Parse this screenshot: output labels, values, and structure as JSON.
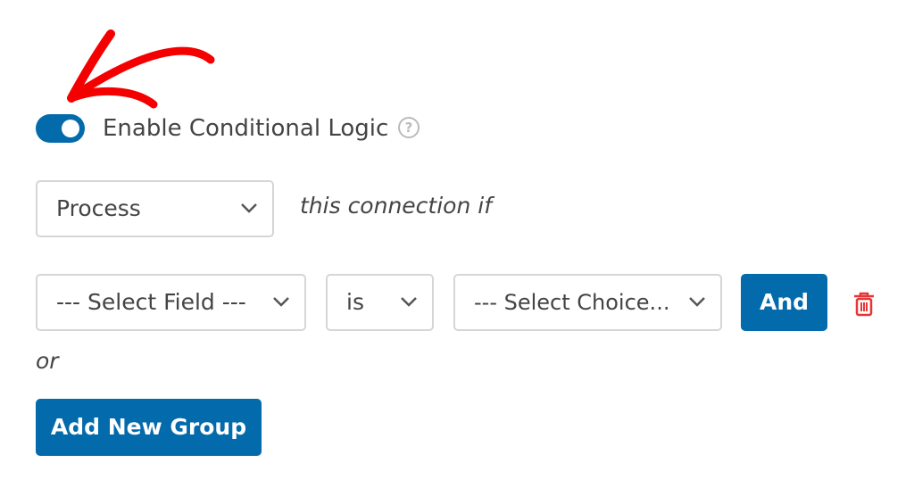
{
  "conditional_logic": {
    "toggle_on": true,
    "label": "Enable Conditional Logic",
    "help_icon": "question-circle-icon",
    "action_select": "Process",
    "connection_text": "this connection if",
    "rule": {
      "field_select": "--- Select Field ---",
      "operator_select": "is",
      "choice_select": "--- Select Choice...",
      "and_label": "And",
      "delete_icon": "trash-icon"
    },
    "or_label": "or",
    "add_group_label": "Add New Group"
  },
  "colors": {
    "accent": "#036aab",
    "delete": "#e63535",
    "annotation_arrow": "#f40000"
  }
}
